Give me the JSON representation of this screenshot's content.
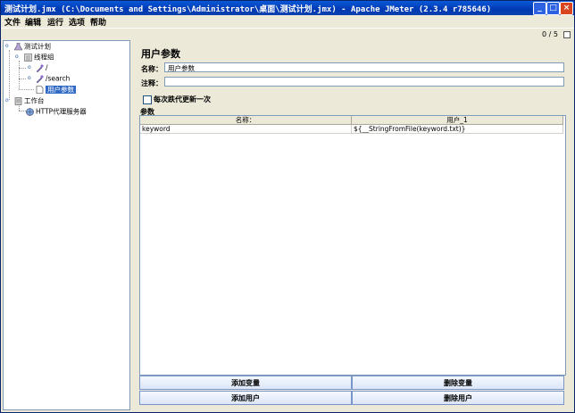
{
  "window": {
    "title": "测试计划.jmx (C:\\Documents and Settings\\Administrator\\桌面\\测试计划.jmx) - Apache JMeter (2.3.4 r785646)"
  },
  "menu": [
    "文件",
    "编辑",
    "运行",
    "选项",
    "帮助"
  ],
  "status": {
    "counter": "0 / 5"
  },
  "tree": {
    "test_plan": "测试计划",
    "thread_group": "线程组",
    "sampler_root": "/",
    "sampler_search": "/search",
    "user_params": "用户参数",
    "workbench": "工作台",
    "http_proxy": "HTTP代理服务器"
  },
  "panel": {
    "title": "用户参数",
    "name_label": "名称：",
    "name_value": "用户参数",
    "comment_label": "注释：",
    "comment_value": "",
    "checkbox_label": "每次跌代更新一次",
    "params_label": "参数",
    "table": {
      "headers": [
        "名称：",
        "用户_1"
      ],
      "rows": [
        [
          "keyword",
          "${__StringFromFile(keyword.txt)}"
        ]
      ]
    },
    "buttons": {
      "add_var": "添加变量",
      "del_var": "删除变量",
      "add_user": "添加用户",
      "del_user": "删除用户"
    }
  },
  "colors": {
    "titlebar": "#0a58d8",
    "selection": "#316ac5",
    "panel_bg": "#ece9d8"
  }
}
